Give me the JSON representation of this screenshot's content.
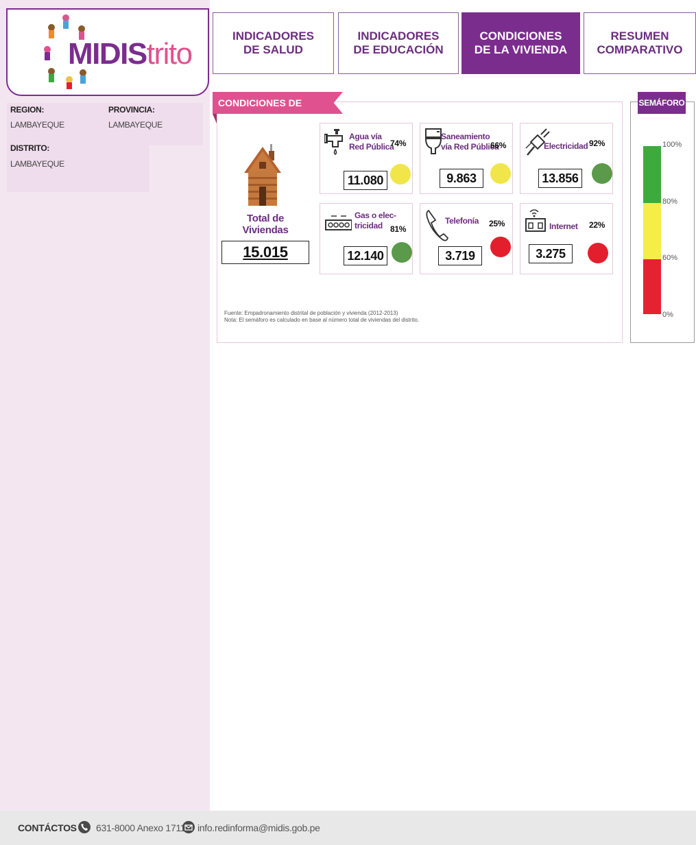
{
  "logo": {
    "text_a": "MIDIS",
    "text_b": "trito"
  },
  "location": {
    "region_label": "REGION:",
    "region_value": "LAMBAYEQUE",
    "provincia_label": "PROVINCIA:",
    "provincia_value": "LAMBAYEQUE",
    "distrito_label": "DISTRITO:",
    "distrito_value": "LAMBAYEQUE"
  },
  "tabs": [
    {
      "label": "INDICADORES\nDE SALUD",
      "active": false
    },
    {
      "label": "INDICADORES\nDE EDUCACIÓN",
      "active": false
    },
    {
      "label": "CONDICIONES\nDE LA VIVIENDA",
      "active": true
    },
    {
      "label": "RESUMEN\nCOMPARATIVO",
      "active": false
    }
  ],
  "section": {
    "title": "CONDICIONES DE VIVIENDA",
    "total_label": "Total de Viviendas",
    "total_value": "15.015",
    "cards": [
      {
        "label": "Agua vía\nRed Pública",
        "pct": "74%",
        "count": "11.080",
        "status": "yellow",
        "icon": "water-tap-icon"
      },
      {
        "label": "Saneamiento\nvía Red Pública",
        "pct": "66%",
        "count": "9.863",
        "status": "yellow",
        "icon": "toilet-icon"
      },
      {
        "label": "Electricidad",
        "pct": "92%",
        "count": "13.856",
        "status": "green",
        "icon": "electric-plug-icon"
      },
      {
        "label": "Gas o elec-\ntricidad",
        "pct": "81%",
        "count": "12.140",
        "status": "green",
        "icon": "stove-icon"
      },
      {
        "label": "Telefonía",
        "pct": "25%",
        "count": "3.719",
        "status": "red",
        "icon": "phone-icon"
      },
      {
        "label": "Internet",
        "pct": "22%",
        "count": "3.275",
        "status": "red",
        "icon": "internet-router-icon"
      }
    ],
    "source_line1": "Fuente: Empadronamiento distrital de población y vivienda (2012-2013)",
    "source_line2": "Nota: El semáforo es calculado en base al número total de viviendas del distrito."
  },
  "semaforo": {
    "title": "SEMÁFORO",
    "ticks": [
      "100%",
      "80%",
      "60%",
      "0%"
    ]
  },
  "colors": {
    "purple": "#7b2d8e",
    "pink": "#e0528f",
    "green": "#5a9a4a",
    "yellow": "#f0e64a",
    "red": "#e41f2d",
    "sem_green": "#3daa3d",
    "sem_yellow": "#f5ee46",
    "sem_red": "#e52330"
  },
  "footer": {
    "contacts_label": "CONTÁCTOS",
    "phone": "631-8000 Anexo 1711",
    "email": "info.redinforma@midis.gob.pe"
  }
}
